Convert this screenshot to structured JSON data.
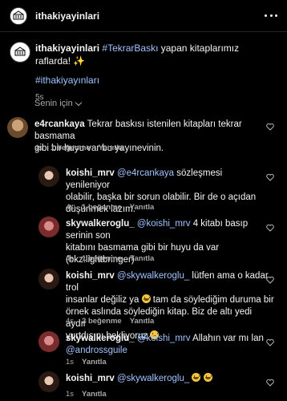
{
  "header": {
    "account_name": "ithakiyayinlari"
  },
  "caption": {
    "username": "ithakiyayinlari",
    "hashtag1": "#TekrarBaskı",
    "text": " yapan kitaplarımız raflarda! ✨",
    "hashtag2": "#ithakiyayınları",
    "time": "5s"
  },
  "sort": {
    "label": "Senin için"
  },
  "comments": [
    {
      "username": "e4rcankaya",
      "text_line1": "Tekrar baskısı istenilen kitapları tekrar basmama",
      "text_line2": "gibi bir huyu var bu yayınevinin.",
      "time": "4s",
      "likes": "1 beğenme",
      "reply": "Yanıtla"
    },
    {
      "username": "koishi_mrv",
      "mention": "@e4rcankaya",
      "text_line1_rest": " sözleşmesi yenileniyor",
      "text_line2": "olabilir, başka bir sorun olabilir. Bir de o açıdan",
      "text_line3": "düşünmek lazım.",
      "time": "4s",
      "likes": "1 beğenme",
      "reply": "Yanıtla"
    },
    {
      "username": "skywalkeroglu_",
      "mention": "@koishi_mrv",
      "text_line1_rest": " 4 kitabı basıp serinin son",
      "text_line2": "kitabını basmama gibi bir huyu da var",
      "text_line3": "(bkz:lightbringer)",
      "time": "4s",
      "likes": "1 beğenme",
      "reply": "Yanıtla"
    },
    {
      "username": "koishi_mrv",
      "mention": "@skywalkeroglu_",
      "text_line1_rest": " lütfen ama o kadar trol",
      "text_line2a": "insanlar değiliz ya ",
      "text_line2b": " tam da söylediğim duruma bir",
      "text_line3": "örnek aslında söylediğin kitap. Biz de altı yedi aydır",
      "text_line4": "yurtdışını bekliyoruz ",
      "time": "4s",
      "likes": "2 beğenme",
      "reply": "Yanıtla"
    },
    {
      "username": "skywalkeroglu_",
      "mention": "@koishi_mrv",
      "text_line1_rest": " Allahın var mı lan",
      "mention2": "@androssguile",
      "time": "1s",
      "reply": "Yanıtla"
    },
    {
      "username": "koishi_mrv",
      "mention": "@skywalkeroglu_",
      "time": "1s",
      "reply": "Yanıtla"
    }
  ]
}
